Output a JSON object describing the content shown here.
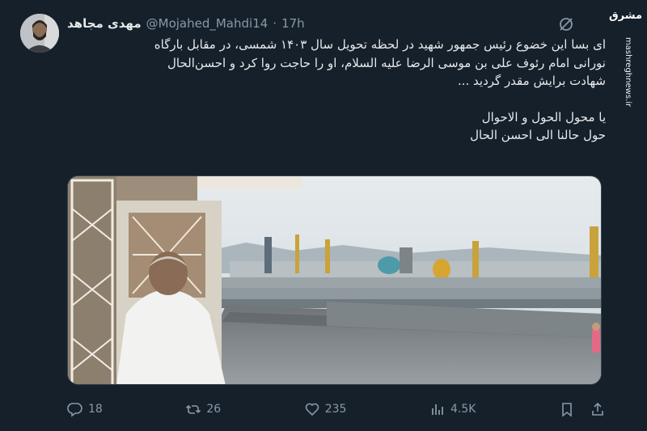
{
  "tweet": {
    "display_name": "مهدی مجاهد",
    "handle": "@Mojahed_Mahdi14",
    "separator": "·",
    "time": "17h",
    "lines": [
      "ای بسا این خضوع رئیس جمهور شهید در لحظه تحویل سال ۱۴۰۳ شمسی، در مقابل بارگاه",
      "نورانی امام رئوف علی بن موسی الرضا علیه السلام، او را حاجت روا کرد و احسن‌الحال",
      "شهادت برایش مقدر گردید ..."
    ],
    "lines2": [
      "یا محول الحول و الاحوال",
      "حول حالنا الی احسن الحال"
    ]
  },
  "actions": {
    "replies": "18",
    "retweets": "26",
    "likes": "235",
    "views": "4.5K"
  },
  "watermark": {
    "logo": "مشرق",
    "url": "mashreghnews.ir"
  },
  "icons": {
    "grok": "grok-icon",
    "reply": "reply-icon",
    "retweet": "retweet-icon",
    "like": "heart-icon",
    "views": "views-icon",
    "bookmark": "bookmark-icon",
    "share": "share-icon"
  },
  "colors": {
    "background": "#15202b",
    "text": "#e7e9ea",
    "muted": "#8b98a5"
  }
}
